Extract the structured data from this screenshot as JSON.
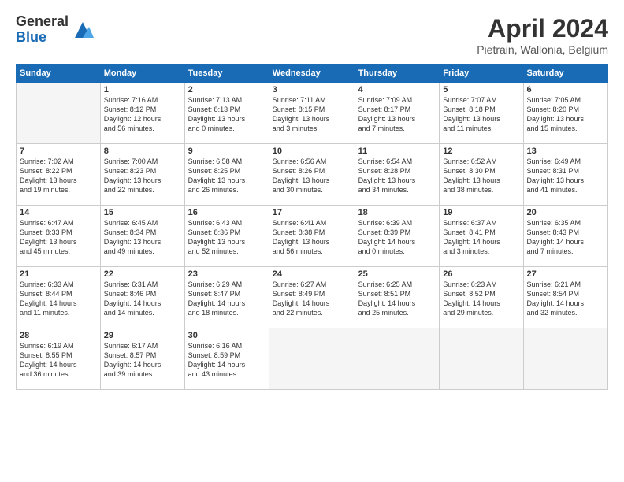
{
  "logo": {
    "general": "General",
    "blue": "Blue"
  },
  "header": {
    "title": "April 2024",
    "location": "Pietrain, Wallonia, Belgium"
  },
  "weekdays": [
    "Sunday",
    "Monday",
    "Tuesday",
    "Wednesday",
    "Thursday",
    "Friday",
    "Saturday"
  ],
  "weeks": [
    [
      {
        "day": "",
        "info": ""
      },
      {
        "day": "1",
        "info": "Sunrise: 7:16 AM\nSunset: 8:12 PM\nDaylight: 12 hours\nand 56 minutes."
      },
      {
        "day": "2",
        "info": "Sunrise: 7:13 AM\nSunset: 8:13 PM\nDaylight: 13 hours\nand 0 minutes."
      },
      {
        "day": "3",
        "info": "Sunrise: 7:11 AM\nSunset: 8:15 PM\nDaylight: 13 hours\nand 3 minutes."
      },
      {
        "day": "4",
        "info": "Sunrise: 7:09 AM\nSunset: 8:17 PM\nDaylight: 13 hours\nand 7 minutes."
      },
      {
        "day": "5",
        "info": "Sunrise: 7:07 AM\nSunset: 8:18 PM\nDaylight: 13 hours\nand 11 minutes."
      },
      {
        "day": "6",
        "info": "Sunrise: 7:05 AM\nSunset: 8:20 PM\nDaylight: 13 hours\nand 15 minutes."
      }
    ],
    [
      {
        "day": "7",
        "info": "Sunrise: 7:02 AM\nSunset: 8:22 PM\nDaylight: 13 hours\nand 19 minutes."
      },
      {
        "day": "8",
        "info": "Sunrise: 7:00 AM\nSunset: 8:23 PM\nDaylight: 13 hours\nand 22 minutes."
      },
      {
        "day": "9",
        "info": "Sunrise: 6:58 AM\nSunset: 8:25 PM\nDaylight: 13 hours\nand 26 minutes."
      },
      {
        "day": "10",
        "info": "Sunrise: 6:56 AM\nSunset: 8:26 PM\nDaylight: 13 hours\nand 30 minutes."
      },
      {
        "day": "11",
        "info": "Sunrise: 6:54 AM\nSunset: 8:28 PM\nDaylight: 13 hours\nand 34 minutes."
      },
      {
        "day": "12",
        "info": "Sunrise: 6:52 AM\nSunset: 8:30 PM\nDaylight: 13 hours\nand 38 minutes."
      },
      {
        "day": "13",
        "info": "Sunrise: 6:49 AM\nSunset: 8:31 PM\nDaylight: 13 hours\nand 41 minutes."
      }
    ],
    [
      {
        "day": "14",
        "info": "Sunrise: 6:47 AM\nSunset: 8:33 PM\nDaylight: 13 hours\nand 45 minutes."
      },
      {
        "day": "15",
        "info": "Sunrise: 6:45 AM\nSunset: 8:34 PM\nDaylight: 13 hours\nand 49 minutes."
      },
      {
        "day": "16",
        "info": "Sunrise: 6:43 AM\nSunset: 8:36 PM\nDaylight: 13 hours\nand 52 minutes."
      },
      {
        "day": "17",
        "info": "Sunrise: 6:41 AM\nSunset: 8:38 PM\nDaylight: 13 hours\nand 56 minutes."
      },
      {
        "day": "18",
        "info": "Sunrise: 6:39 AM\nSunset: 8:39 PM\nDaylight: 14 hours\nand 0 minutes."
      },
      {
        "day": "19",
        "info": "Sunrise: 6:37 AM\nSunset: 8:41 PM\nDaylight: 14 hours\nand 3 minutes."
      },
      {
        "day": "20",
        "info": "Sunrise: 6:35 AM\nSunset: 8:43 PM\nDaylight: 14 hours\nand 7 minutes."
      }
    ],
    [
      {
        "day": "21",
        "info": "Sunrise: 6:33 AM\nSunset: 8:44 PM\nDaylight: 14 hours\nand 11 minutes."
      },
      {
        "day": "22",
        "info": "Sunrise: 6:31 AM\nSunset: 8:46 PM\nDaylight: 14 hours\nand 14 minutes."
      },
      {
        "day": "23",
        "info": "Sunrise: 6:29 AM\nSunset: 8:47 PM\nDaylight: 14 hours\nand 18 minutes."
      },
      {
        "day": "24",
        "info": "Sunrise: 6:27 AM\nSunset: 8:49 PM\nDaylight: 14 hours\nand 22 minutes."
      },
      {
        "day": "25",
        "info": "Sunrise: 6:25 AM\nSunset: 8:51 PM\nDaylight: 14 hours\nand 25 minutes."
      },
      {
        "day": "26",
        "info": "Sunrise: 6:23 AM\nSunset: 8:52 PM\nDaylight: 14 hours\nand 29 minutes."
      },
      {
        "day": "27",
        "info": "Sunrise: 6:21 AM\nSunset: 8:54 PM\nDaylight: 14 hours\nand 32 minutes."
      }
    ],
    [
      {
        "day": "28",
        "info": "Sunrise: 6:19 AM\nSunset: 8:55 PM\nDaylight: 14 hours\nand 36 minutes."
      },
      {
        "day": "29",
        "info": "Sunrise: 6:17 AM\nSunset: 8:57 PM\nDaylight: 14 hours\nand 39 minutes."
      },
      {
        "day": "30",
        "info": "Sunrise: 6:16 AM\nSunset: 8:59 PM\nDaylight: 14 hours\nand 43 minutes."
      },
      {
        "day": "",
        "info": ""
      },
      {
        "day": "",
        "info": ""
      },
      {
        "day": "",
        "info": ""
      },
      {
        "day": "",
        "info": ""
      }
    ]
  ]
}
